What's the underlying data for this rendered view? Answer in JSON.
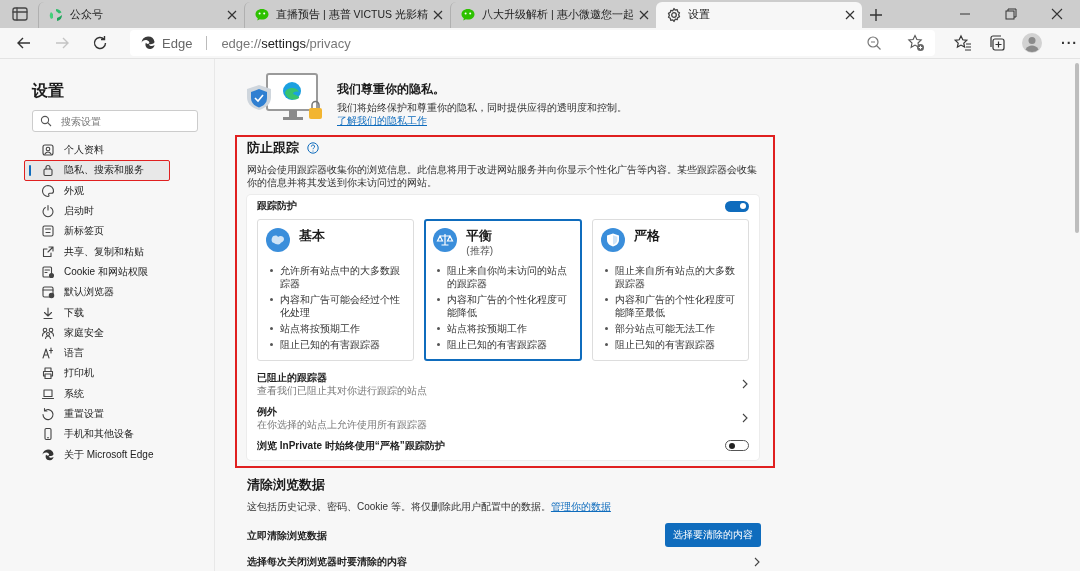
{
  "tabs": [
    {
      "kind": "sync",
      "title": "公众号",
      "selected": false
    },
    {
      "kind": "chat",
      "title": "直播预告 | 惠普 VICTUS 光影精",
      "selected": false
    },
    {
      "kind": "chat",
      "title": "八大升级解析 | 惠小微邀您一起",
      "selected": false
    },
    {
      "kind": "gear",
      "title": "设置",
      "selected": true
    }
  ],
  "nav": [
    {
      "kind": "back",
      "disabled": false
    },
    {
      "kind": "forward",
      "disabled": true
    },
    {
      "kind": "refresh",
      "disabled": false
    }
  ],
  "address": {
    "badge": "Edge",
    "prefix": "edge://",
    "host": "settings",
    "path": "/privacy"
  },
  "more_menu": "···",
  "sidebar": {
    "title": "设置",
    "search": {
      "placeholder": "搜索设置"
    },
    "items": [
      {
        "label": "个人资料",
        "selected": false,
        "annotated": false
      },
      {
        "label": "隐私、搜索和服务",
        "selected": true,
        "annotated": true
      },
      {
        "label": "外观",
        "selected": false,
        "annotated": false
      },
      {
        "label": "启动时",
        "selected": false,
        "annotated": false
      },
      {
        "label": "新标签页",
        "selected": false,
        "annotated": false
      },
      {
        "label": "共享、复制和粘贴",
        "selected": false,
        "annotated": false
      },
      {
        "label": "Cookie 和网站权限",
        "selected": false,
        "annotated": false
      },
      {
        "label": "默认浏览器",
        "selected": false,
        "annotated": false
      },
      {
        "label": "下载",
        "selected": false,
        "annotated": false
      },
      {
        "label": "家庭安全",
        "selected": false,
        "annotated": false
      },
      {
        "label": "语言",
        "selected": false,
        "annotated": false
      },
      {
        "label": "打印机",
        "selected": false,
        "annotated": false
      },
      {
        "label": "系统",
        "selected": false,
        "annotated": false
      },
      {
        "label": "重置设置",
        "selected": false,
        "annotated": false
      },
      {
        "label": "手机和其他设备",
        "selected": false,
        "annotated": false
      },
      {
        "label": "关于 Microsoft Edge",
        "selected": false,
        "annotated": false
      }
    ]
  },
  "intro": {
    "title": "我们尊重你的隐私。",
    "text": "我们将始终保护和尊重你的隐私，同时提供应得的透明度和控制。",
    "link": "了解我们的隐私工作"
  },
  "tracking": {
    "title": "防止跟踪",
    "annotated": true,
    "description": "网站会使用跟踪器收集你的浏览信息。此信息将用于改进网站服务并向你显示个性化广告等内容。某些跟踪器会收集你的信息并将其发送到你未访问过的网站。",
    "protection": {
      "label": "跟踪防护",
      "on": true
    },
    "levels": [
      {
        "title": "基本",
        "selected": false,
        "bullets": [
          "允许所有站点中的大多数跟踪器",
          "内容和广告可能会经过个性化处理",
          "站点将按预期工作",
          "阻止已知的有害跟踪器"
        ]
      },
      {
        "title": "平衡",
        "note": "(推荐)",
        "selected": true,
        "bullets": [
          "阻止来自你尚未访问的站点的跟踪器",
          "内容和广告的个性化程度可能降低",
          "站点将按预期工作",
          "阻止已知的有害跟踪器"
        ]
      },
      {
        "title": "严格",
        "selected": false,
        "bullets": [
          "阻止来自所有站点的大多数跟踪器",
          "内容和广告的个性化程度可能降至最低",
          "部分站点可能无法工作",
          "阻止已知的有害跟踪器"
        ]
      }
    ],
    "rows": [
      {
        "kind": "link",
        "title": "已阻止的跟踪器",
        "subtitle": "查看我们已阻止其对你进行跟踪的站点"
      },
      {
        "kind": "link",
        "title": "例外",
        "subtitle": "在你选择的站点上允许使用所有跟踪器"
      },
      {
        "kind": "toggle",
        "title": "浏览 InPrivate 时始终使用“严格”跟踪防护",
        "on": false
      }
    ]
  },
  "clear": {
    "title": "清除浏览数据",
    "text": "这包括历史记录、密码、Cookie 等。将仅删除此用户配置中的数据。",
    "link": "管理你的数据",
    "rows": [
      {
        "kind": "button",
        "title": "立即清除浏览数据",
        "button": "选择要清除的内容"
      },
      {
        "kind": "link",
        "title": "选择每次关闭浏览器时要清除的内容"
      }
    ]
  }
}
